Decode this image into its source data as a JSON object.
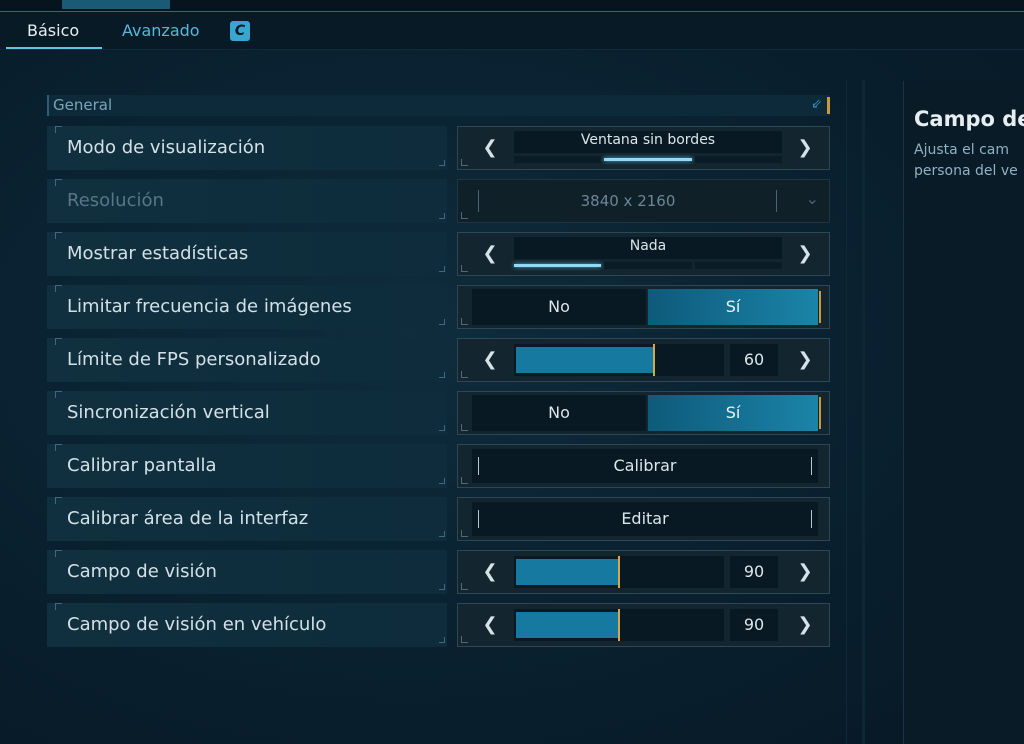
{
  "tabs": {
    "basic": "Básico",
    "advanced": "Avanzado",
    "key_hint": "C"
  },
  "section": {
    "title": "General",
    "collapse_icon": "collapse-arrow-icon"
  },
  "settings": {
    "display_mode": {
      "label": "Modo de visualización",
      "value": "Ventana sin bordes",
      "options_count": 3,
      "selected_index": 1
    },
    "resolution": {
      "label": "Resolución",
      "value": "3840 x 2160",
      "disabled": true
    },
    "show_stats": {
      "label": "Mostrar estadísticas",
      "value": "Nada",
      "options_count": 3,
      "selected_index": 0
    },
    "limit_framerate": {
      "label": "Limitar frecuencia de imágenes",
      "off": "No",
      "on": "Sí",
      "selected": "Sí"
    },
    "fps_limit": {
      "label": "Límite de FPS personalizado",
      "value": "60",
      "fill_fraction": 0.67
    },
    "vsync": {
      "label": "Sincronización vertical",
      "off": "No",
      "on": "Sí",
      "selected": "Sí"
    },
    "calibrate_screen": {
      "label": "Calibrar pantalla",
      "button": "Calibrar"
    },
    "calibrate_ui": {
      "label": "Calibrar área de la interfaz",
      "button": "Editar"
    },
    "fov": {
      "label": "Campo de visión",
      "value": "90",
      "fill_fraction": 0.5
    },
    "vehicle_fov": {
      "label": "Campo de visión en vehículo",
      "value": "90",
      "fill_fraction": 0.5
    }
  },
  "info_panel": {
    "title": "Campo de",
    "line1": "Ajusta el cam",
    "line2": "persona del ve"
  },
  "colors": {
    "accent": "#5fc6ea",
    "fill": "#167aa0",
    "handle": "#d8a645",
    "background": "#0a2232"
  }
}
